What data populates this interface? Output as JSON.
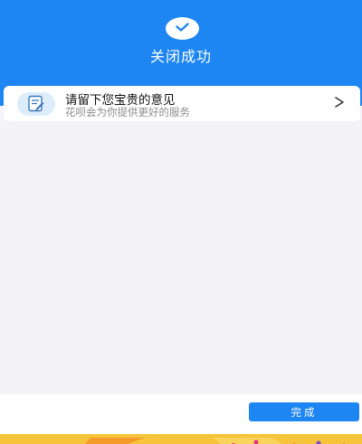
{
  "header": {
    "title": "关闭成功",
    "icon": "check-icon"
  },
  "feedback": {
    "title": "请留下您宝贵的意见",
    "subtitle": "花呗会为你提供更好的服务",
    "icon": "feedback-edit-icon",
    "chevron": "chevron-right-icon"
  },
  "footer": {
    "done_label": "完成"
  },
  "colors": {
    "brand_blue": "#1e86f2",
    "background": "#f4f3f8",
    "banner_yellow": "#f6c43a"
  }
}
